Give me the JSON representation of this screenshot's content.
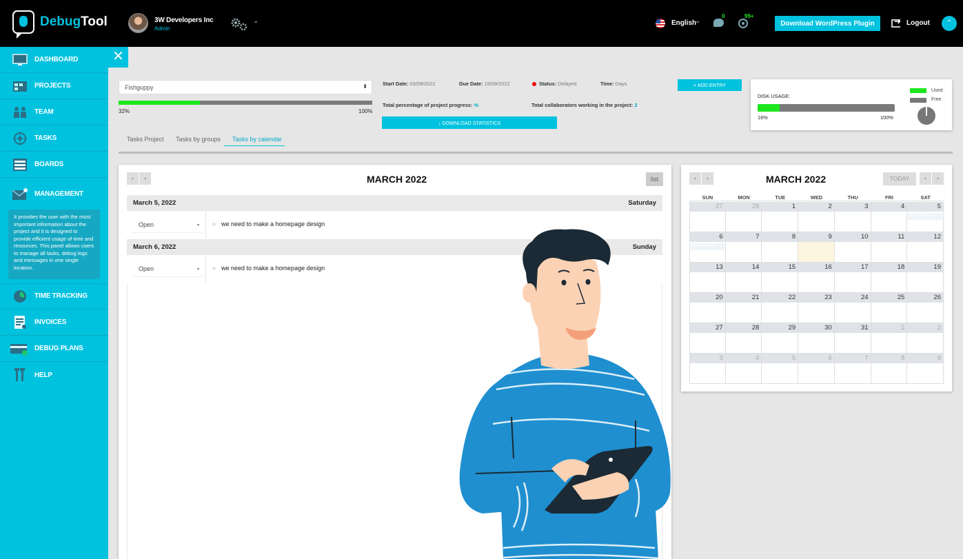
{
  "header": {
    "logo_part1": "Debug",
    "logo_part2": "Tool",
    "company": "3W Developers Inc",
    "role": "Admin",
    "language": "English",
    "messages_count": "0",
    "notifications_count": "99+",
    "download_plugin_label": "Download WordPress Plugin",
    "logout_label": "Logout",
    "up_arrow": "⌃",
    "caret": "⌄"
  },
  "sidebar": {
    "close_label": "✕",
    "items": [
      {
        "label": "DASHBOARD",
        "icon": "monitor-icon"
      },
      {
        "label": "PROJECTS",
        "icon": "projects-icon"
      },
      {
        "label": "TEAM",
        "icon": "team-icon"
      },
      {
        "label": "TASKS",
        "icon": "target-icon"
      },
      {
        "label": "BOARDS",
        "icon": "boards-icon"
      },
      {
        "label": "MANAGEMENT",
        "icon": "mail-icon"
      },
      {
        "label": "TIME TRACKING",
        "icon": "clock-icon"
      },
      {
        "label": "INVOICES",
        "icon": "invoice-icon"
      },
      {
        "label": "DEBUG PLANS",
        "icon": "card-icon"
      },
      {
        "label": "HELP",
        "icon": "tools-icon"
      }
    ],
    "management_description": "It provides the user with the most important information about the project and it is designed to provide efficient usage of time and resources. This panel allows users to manage all tasks, debug logs and messages in one single location."
  },
  "project": {
    "selected": "Fishguppy",
    "select_arrow": "⬍",
    "progress": 0.32,
    "progress_min": "32%",
    "progress_max": "100%",
    "start_date_label": "Start Date:",
    "start_date": "03/09/2022",
    "due_date_label": "Due Date:",
    "due_date": "15/09/2022",
    "status_label": "Status:",
    "status": "Delayed",
    "time_label": "Time:",
    "time": "Days",
    "total_progress_label": "Total percentage of project progress:",
    "total_progress_value": "%",
    "collaborators_label": "Total collaborators working in the project:",
    "collaborators_value": "2",
    "download_stats_label": "↓ DOWNLOAD STATISTICS",
    "add_entry_label": "+ ADD ENTRY",
    "colors": {
      "accent": "#00c2df",
      "progress": "#1ee61e",
      "status_delayed": "#e00000"
    }
  },
  "disk": {
    "title": "DISK USAGE:",
    "used_fraction": 0.16,
    "min_label": "16%",
    "max_label": "100%",
    "legend_used": "Used",
    "legend_free": "Free"
  },
  "tabs": [
    {
      "label": "Tasks Project",
      "active": false
    },
    {
      "label": "Tasks by groups",
      "active": false
    },
    {
      "label": "Tasks by calendar",
      "active": true
    }
  ],
  "calendar_list": {
    "title": "MARCH 2022",
    "prev": "‹",
    "next": "›",
    "view_button": "list",
    "days": [
      {
        "date": "March 5, 2022",
        "weekday": "Saturday",
        "status": "Open",
        "task": "we need to make a homepage design"
      },
      {
        "date": "March 6, 2022",
        "weekday": "Sunday",
        "status": "Open",
        "task": "we need to make a homepage design"
      }
    ],
    "dropdown_arrow": "⌄"
  },
  "mini_calendar": {
    "title": "MARCH 2022",
    "today_label": "TODAY",
    "prev": "‹",
    "next": "›",
    "weekdays": [
      "SUN",
      "MON",
      "TUE",
      "WED",
      "THU",
      "FRI",
      "SAT"
    ],
    "weeks": [
      [
        "27",
        "28",
        "1",
        "2",
        "3",
        "4",
        "5"
      ],
      [
        "6",
        "7",
        "8",
        "9",
        "10",
        "11",
        "12"
      ],
      [
        "13",
        "14",
        "15",
        "16",
        "17",
        "18",
        "19"
      ],
      [
        "20",
        "21",
        "22",
        "23",
        "24",
        "25",
        "26"
      ],
      [
        "27",
        "28",
        "29",
        "30",
        "31",
        "1",
        "2"
      ],
      [
        "3",
        "4",
        "5",
        "6",
        "7",
        "8",
        "9"
      ]
    ],
    "event_sat": "we need to",
    "event_sun": "we need to"
  }
}
